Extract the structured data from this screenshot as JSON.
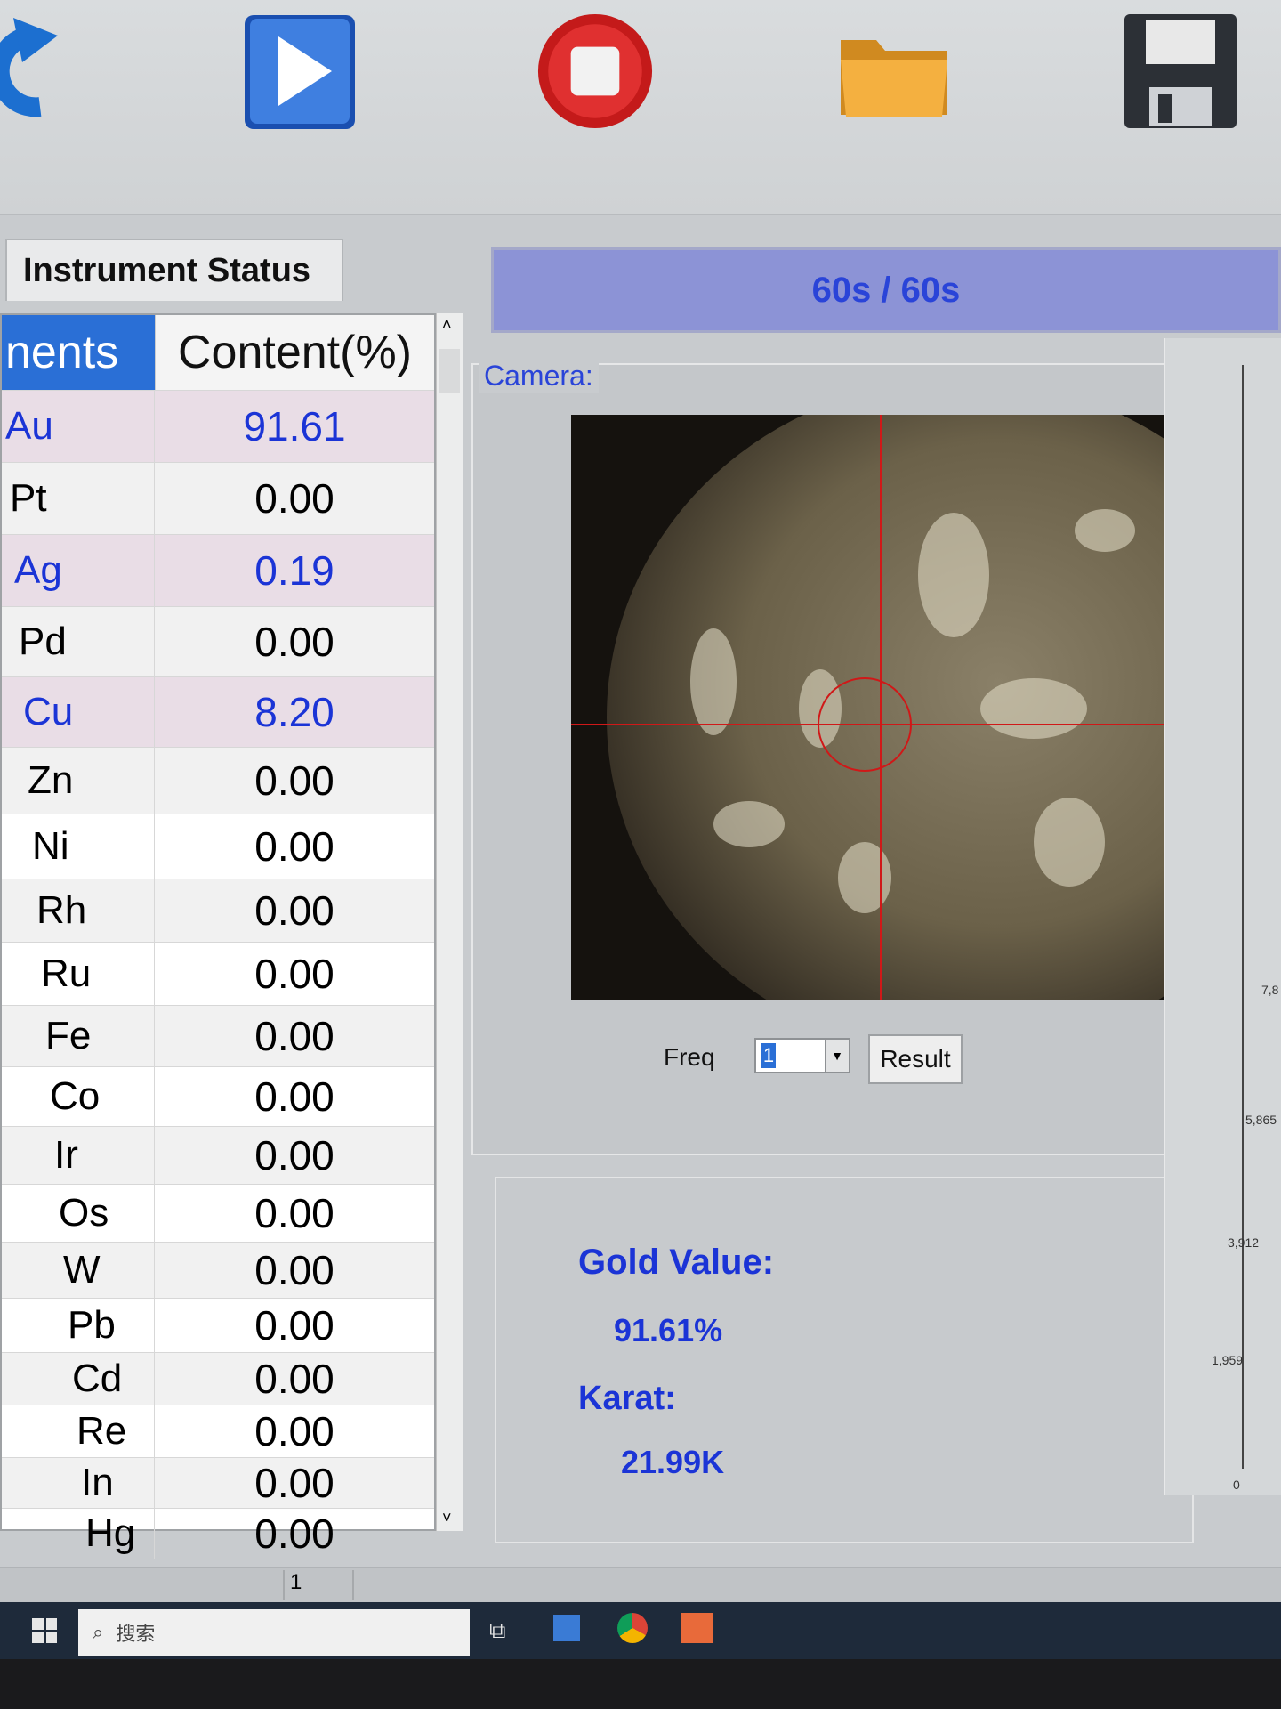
{
  "toolbar": {
    "buttons": [
      {
        "name": "refresh",
        "icon": "refresh-icon"
      },
      {
        "name": "start",
        "icon": "play-icon"
      },
      {
        "name": "stop",
        "icon": "stop-icon"
      },
      {
        "name": "open",
        "icon": "folder-icon"
      },
      {
        "name": "save",
        "icon": "floppy-disk-icon"
      }
    ]
  },
  "status_tab": {
    "label": "Instrument Status"
  },
  "progress": {
    "text": "60s / 60s",
    "fraction": 1.0
  },
  "table": {
    "headers": {
      "element": "nents",
      "content": "Content(%)"
    },
    "rows": [
      {
        "el": "Au",
        "val": "91.61",
        "hi": true
      },
      {
        "el": "Pt",
        "val": "0.00",
        "hi": false
      },
      {
        "el": "Ag",
        "val": "0.19",
        "hi": true
      },
      {
        "el": "Pd",
        "val": "0.00",
        "hi": false
      },
      {
        "el": "Cu",
        "val": "8.20",
        "hi": true
      },
      {
        "el": "Zn",
        "val": "0.00",
        "hi": false
      },
      {
        "el": "Ni",
        "val": "0.00",
        "hi": false
      },
      {
        "el": "Rh",
        "val": "0.00",
        "hi": false
      },
      {
        "el": "Ru",
        "val": "0.00",
        "hi": false
      },
      {
        "el": "Fe",
        "val": "0.00",
        "hi": false
      },
      {
        "el": "Co",
        "val": "0.00",
        "hi": false
      },
      {
        "el": "Ir",
        "val": "0.00",
        "hi": false
      },
      {
        "el": "Os",
        "val": "0.00",
        "hi": false
      },
      {
        "el": "W",
        "val": "0.00",
        "hi": false
      },
      {
        "el": "Pb",
        "val": "0.00",
        "hi": false
      },
      {
        "el": "Cd",
        "val": "0.00",
        "hi": false
      },
      {
        "el": "Re",
        "val": "0.00",
        "hi": false
      },
      {
        "el": "In",
        "val": "0.00",
        "hi": false
      },
      {
        "el": "Hg",
        "val": "0.00",
        "hi": false
      }
    ]
  },
  "camera": {
    "label": "Camera:"
  },
  "freq": {
    "label": "Freq",
    "value": "1"
  },
  "result_button": {
    "label": "Result"
  },
  "gold": {
    "gold_value_label": "Gold Value:",
    "gold_value": "91.61%",
    "karat_label": "Karat:",
    "karat_value": "21.99K"
  },
  "right_chart": {
    "ticks": [
      "7,8",
      "5,865",
      "3,912",
      "1,959",
      "0"
    ]
  },
  "statusbar": {
    "page": "1"
  },
  "taskbar": {
    "search_placeholder": "搜索"
  },
  "colors": {
    "accent_blue": "#1b34d6",
    "header_blue": "#2a6fd6",
    "progress_fill": "#8c93d6",
    "crosshair": "#d01818"
  }
}
